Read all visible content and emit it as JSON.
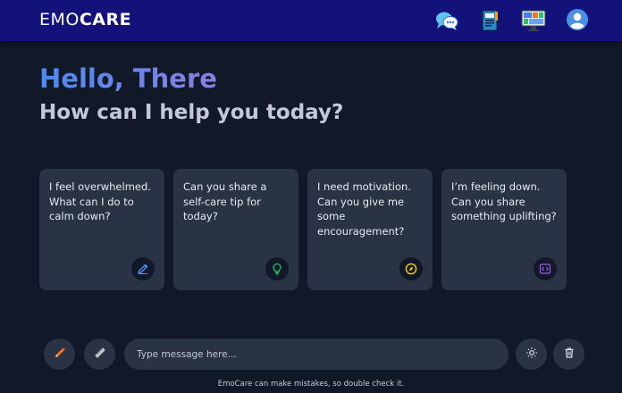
{
  "app": {
    "logo_part1": "EMO",
    "logo_part2": "CARE"
  },
  "nav": {
    "icons": [
      "chat-bubbles-icon",
      "journal-notebook-icon",
      "monitor-dashboard-icon",
      "user-profile-icon"
    ]
  },
  "hero": {
    "greeting": "Hello, There",
    "subtitle": "How can I help you today?"
  },
  "cards": [
    {
      "text": "I feel overwhelmed. What can I do to calm down?",
      "icon": "pencil-edit-icon",
      "icon_color": "#4f8ef7"
    },
    {
      "text": "Can you share a self-care tip for today?",
      "icon": "lightbulb-icon",
      "icon_color": "#22c55e"
    },
    {
      "text": "I need motivation. Can you give me some encouragement?",
      "icon": "compass-icon",
      "icon_color": "#facc15"
    },
    {
      "text": "I’m feeling down. Can you share something uplifting?",
      "icon": "code-icon",
      "icon_color": "#a855f7"
    }
  ],
  "composer": {
    "placeholder": "Type message here...",
    "left_icons": [
      "pencil-icon",
      "ruler-icon"
    ],
    "right_icons": [
      "sun-theme-icon",
      "trash-icon"
    ]
  },
  "footer": {
    "disclaimer": "EmoCare can make mistakes, so double check it."
  },
  "colors": {
    "background": "#111827",
    "topbar": "#12127a",
    "card": "#2a3344",
    "greeting_gradient": [
      "#4a8bf0",
      "#8b7fe0"
    ]
  }
}
